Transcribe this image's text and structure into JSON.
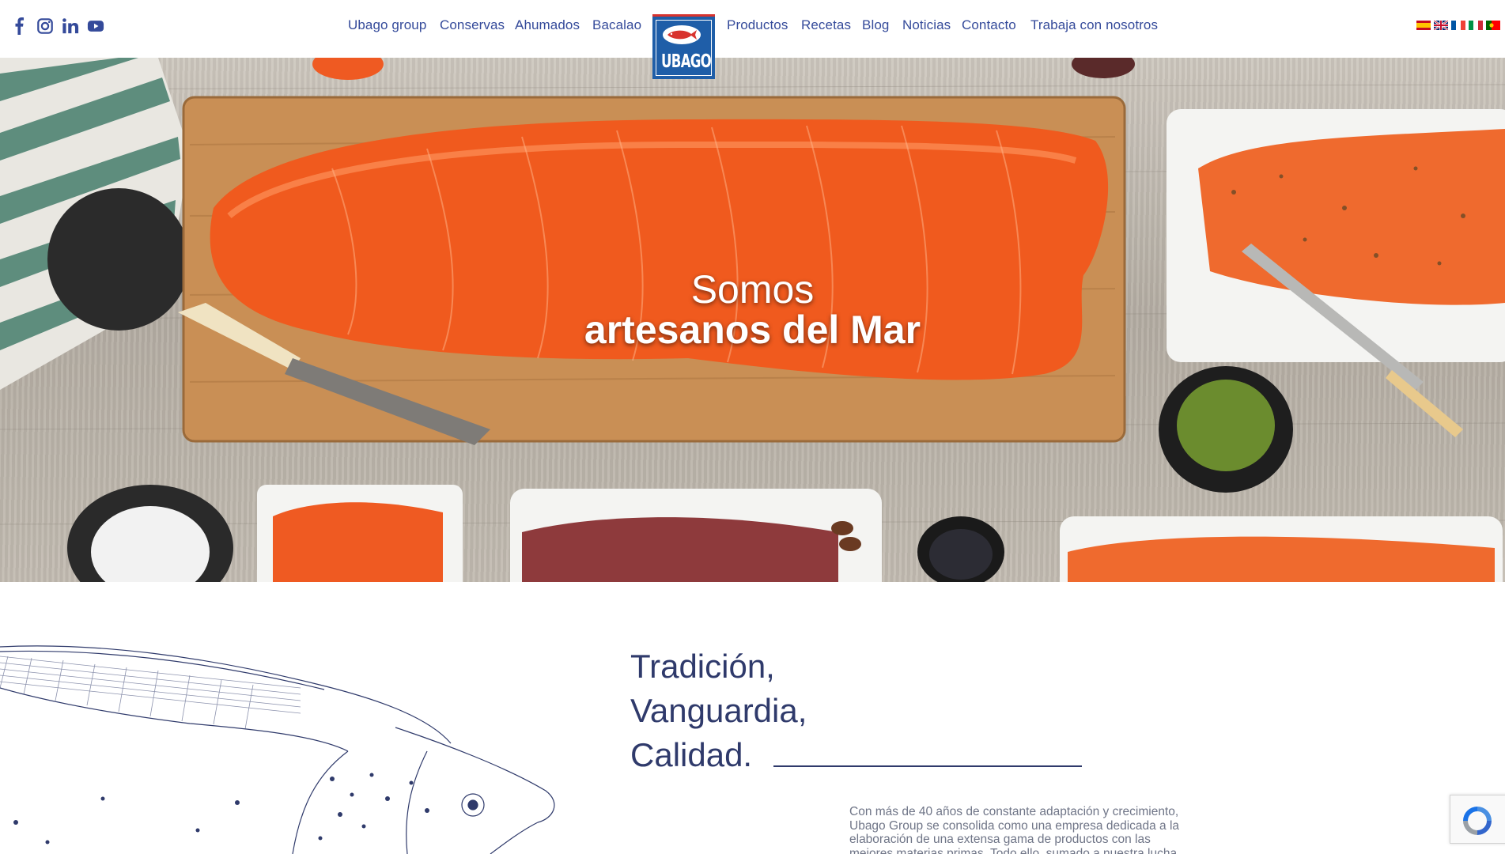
{
  "header": {
    "social": [
      {
        "icon": "facebook-icon",
        "label": "Facebook"
      },
      {
        "icon": "instagram-icon",
        "label": "Instagram"
      },
      {
        "icon": "linkedin-icon",
        "label": "LinkedIn"
      },
      {
        "icon": "youtube-icon",
        "label": "YouTube"
      }
    ],
    "nav": [
      "Ubago group",
      "Conservas",
      "Ahumados",
      "Bacalao",
      "Productos",
      "Recetas",
      "Blog",
      "Noticias",
      "Contacto",
      "Trabaja con nosotros"
    ],
    "logo_text": "UBAGO",
    "languages": [
      "es",
      "en",
      "fr",
      "it",
      "pt"
    ]
  },
  "hero": {
    "line1": "Somos",
    "line2": "artesanos del Mar"
  },
  "intro": {
    "title_lines": [
      "Tradición,",
      "Vanguardia,",
      "Calidad."
    ],
    "body": "Con más de 40 años de constante adaptación y crecimiento, Ubago Group se consolida como una empresa dedicada a la elaboración de una extensa gama de productos con las mejores materias primas. Todo ello, sumado a nuestra lucha"
  },
  "colors": {
    "nav": "#344a9a",
    "brand_blue": "#1f5ea8",
    "brand_red": "#d8332e",
    "title": "#2f3a6b",
    "body_text": "#6f7587"
  }
}
